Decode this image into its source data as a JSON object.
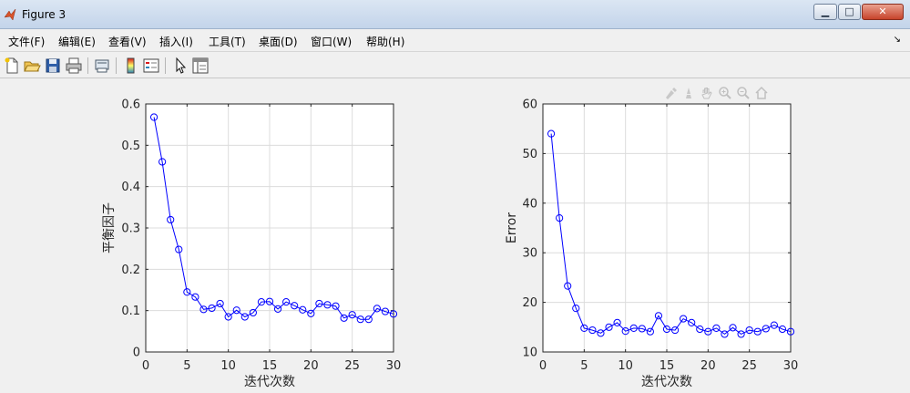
{
  "window": {
    "title": "Figure 3",
    "minimize_glyph": "▁",
    "maximize_glyph": "□",
    "close_glyph": "✕"
  },
  "menu": {
    "items": [
      "文件(F)",
      "编辑(E)",
      "查看(V)",
      "插入(I)",
      "工具(T)",
      "桌面(D)",
      "窗口(W)",
      "帮助(H)"
    ],
    "corner_glyph": "↘"
  },
  "toolbar": {
    "tools": [
      "new-figure-icon",
      "open-file-icon",
      "save-icon",
      "print-icon",
      "print-preview-icon",
      "colorbar-icon",
      "legend-icon",
      "pointer-icon",
      "property-inspector-icon"
    ]
  },
  "plot_tools": [
    "brush-icon",
    "data-cursor-icon",
    "pan-icon",
    "zoom-in-icon",
    "zoom-out-icon",
    "home-icon"
  ],
  "colors": {
    "line": "#0000ff",
    "grid": "#dcdcdc",
    "axes_bg": "#ffffff"
  },
  "chart_data": [
    {
      "type": "line",
      "xlabel": "迭代次数",
      "ylabel": "平衡因子",
      "xlim": [
        0,
        30
      ],
      "ylim": [
        0,
        0.6
      ],
      "xticks": [
        0,
        5,
        10,
        15,
        20,
        25,
        30
      ],
      "yticks": [
        0,
        0.1,
        0.2,
        0.3,
        0.4,
        0.5,
        0.6
      ],
      "ytick_labels": [
        "0",
        "0.1",
        "0.2",
        "0.3",
        "0.4",
        "0.5",
        "0.6"
      ],
      "grid": true,
      "marker": "circle",
      "x": [
        1,
        2,
        3,
        4,
        5,
        6,
        7,
        8,
        9,
        10,
        11,
        12,
        13,
        14,
        15,
        16,
        17,
        18,
        19,
        20,
        21,
        22,
        23,
        24,
        25,
        26,
        27,
        28,
        29,
        30
      ],
      "y": [
        0.568,
        0.46,
        0.32,
        0.248,
        0.145,
        0.133,
        0.103,
        0.106,
        0.117,
        0.085,
        0.101,
        0.085,
        0.095,
        0.121,
        0.122,
        0.104,
        0.121,
        0.112,
        0.102,
        0.093,
        0.117,
        0.114,
        0.111,
        0.082,
        0.09,
        0.079,
        0.079,
        0.105,
        0.098,
        0.092
      ]
    },
    {
      "type": "line",
      "xlabel": "迭代次数",
      "ylabel": "Error",
      "xlim": [
        0,
        30
      ],
      "ylim": [
        10,
        60
      ],
      "xticks": [
        0,
        5,
        10,
        15,
        20,
        25,
        30
      ],
      "yticks": [
        10,
        20,
        30,
        40,
        50,
        60
      ],
      "ytick_labels": [
        "10",
        "20",
        "30",
        "40",
        "50",
        "60"
      ],
      "grid": true,
      "marker": "circle",
      "x": [
        1,
        2,
        3,
        4,
        5,
        6,
        7,
        8,
        9,
        10,
        11,
        12,
        13,
        14,
        15,
        16,
        17,
        18,
        19,
        20,
        21,
        22,
        23,
        24,
        25,
        26,
        27,
        28,
        29,
        30
      ],
      "y": [
        54.0,
        37.0,
        23.3,
        18.8,
        14.8,
        14.4,
        13.8,
        15.0,
        15.9,
        14.2,
        14.8,
        14.7,
        14.1,
        17.3,
        14.6,
        14.4,
        16.7,
        15.9,
        14.6,
        14.1,
        14.8,
        13.6,
        14.9,
        13.6,
        14.4,
        14.1,
        14.7,
        15.4,
        14.6,
        14.1
      ]
    }
  ]
}
